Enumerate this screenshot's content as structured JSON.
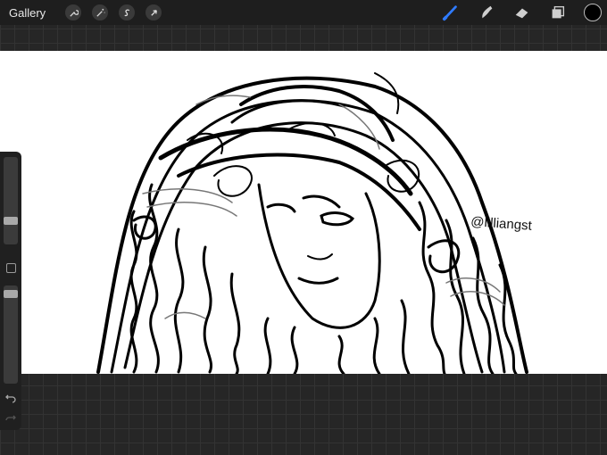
{
  "toolbar": {
    "gallery_label": "Gallery",
    "left_tools": [
      "wrench-icon",
      "magic-wand-icon",
      "selection-s-icon",
      "arrow-cursor-icon"
    ],
    "right_tools": [
      "brush-icon",
      "smudge-icon",
      "eraser-icon",
      "layers-icon"
    ],
    "brush_color": "#000000",
    "active_tool_color": "#2f7bff"
  },
  "canvas": {
    "signature": "@lilliangst",
    "background": "#ffffff"
  },
  "sidebar": {
    "brush_size_level": 0.25,
    "opacity_level": 0.95,
    "modify_button": "square-icon",
    "undo": "undo-icon",
    "redo": "redo-icon"
  }
}
